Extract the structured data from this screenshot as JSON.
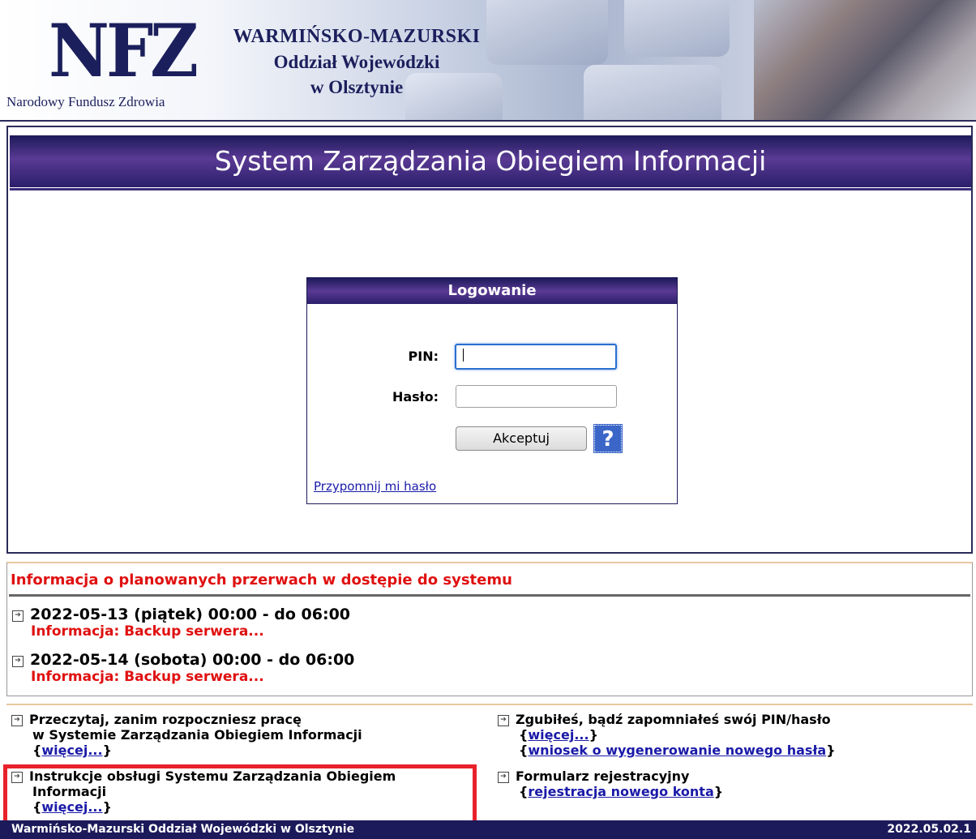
{
  "header": {
    "logo_text": "NFZ",
    "logo_subtitle": "Narodowy Fundusz Zdrowia",
    "region_line1": "WARMIŃSKO-MAZURSKI",
    "region_line2": "Oddział Wojewódzki",
    "region_line3": "w Olsztynie"
  },
  "title": "System Zarządzania Obiegiem Informacji",
  "login": {
    "heading": "Logowanie",
    "pin_label": "PIN:",
    "pin_value": "",
    "password_label": "Hasło:",
    "password_value": "",
    "accept_label": "Akceptuj",
    "help_label": "?",
    "remind_label": "Przypomnij mi hasło"
  },
  "info": {
    "heading": "Informacja o planowanych przerwach w dostępie do systemu",
    "entries": [
      {
        "date": "2022-05-13 (piątek) 00:00 - do 06:00",
        "desc": "Informacja: Backup serwera..."
      },
      {
        "date": "2022-05-14 (sobota) 00:00 - do 06:00",
        "desc": "Informacja: Backup serwera..."
      }
    ]
  },
  "links": {
    "read_first_line1": "Przeczytaj, zanim rozpoczniesz pracę",
    "read_first_line2": "w Systemie Zarządzania Obiegiem Informacji",
    "read_first_more": "więcej...",
    "instructions_line1": "Instrukcje obsługi Systemu Zarządzania Obiegiem",
    "instructions_line2": "Informacji",
    "instructions_more": "więcej...",
    "lost_pin": "Zgubiłeś, bądź zapomniałeś swój PIN/hasło",
    "lost_pin_more": "więcej...",
    "new_password_request": "wniosek o wygenerowanie nowego hasła",
    "registration_form": "Formularz rejestracyjny",
    "registration_link": "rejestracja nowego konta",
    "brace_open": "{",
    "brace_close": "}"
  },
  "footer": {
    "left": "Warmińsko-Mazurski Oddział Wojewódzki w Olsztynie",
    "version": "2022.05.02.1"
  },
  "icons": {
    "bullet": "arrow-box-icon",
    "help": "help-icon"
  },
  "colors": {
    "navy": "#1c1a5a",
    "purple": "#5a3a94",
    "alert_red": "#e01010",
    "link_blue": "#1a1aa8",
    "highlight_red": "#e8222b"
  }
}
